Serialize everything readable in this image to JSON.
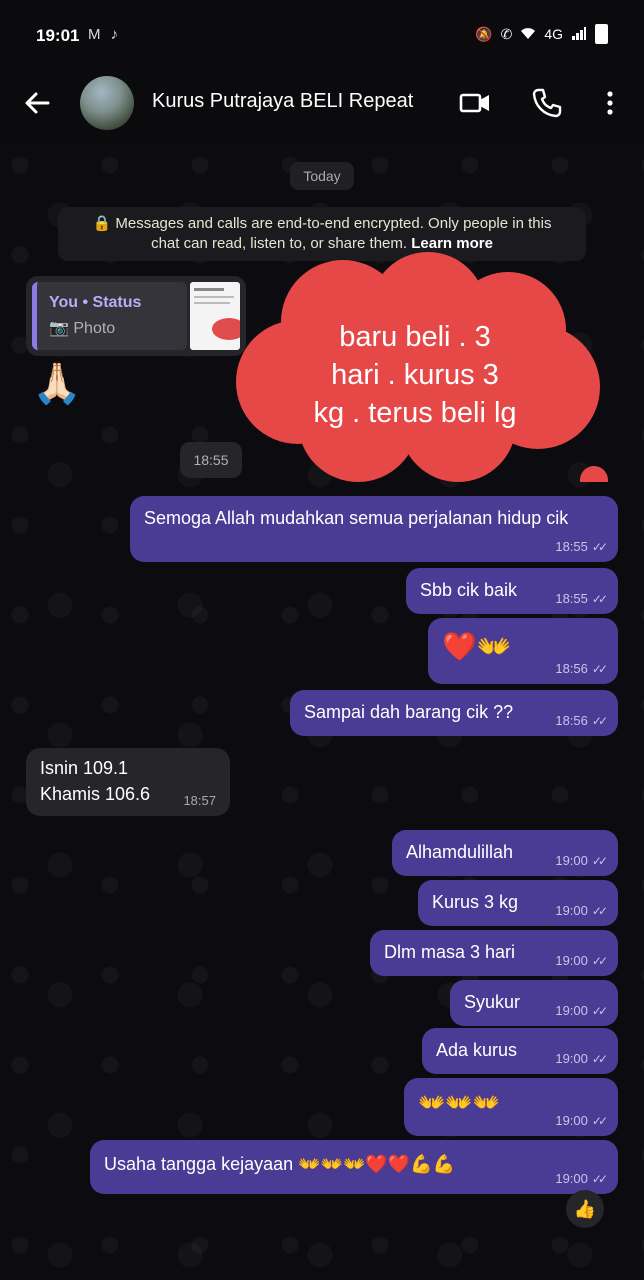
{
  "status_bar": {
    "time": "19:01",
    "left_icons": [
      "gmail-icon",
      "tiktok-icon"
    ],
    "network": "4G",
    "right_icons": [
      "mute-icon",
      "wifi-call-icon",
      "wifi-icon",
      "signal-icon",
      "battery-icon"
    ]
  },
  "header": {
    "title": "Kurus Putrajaya BELI Repeat",
    "icons": [
      "back-arrow-icon",
      "video-call-icon",
      "phone-icon",
      "more-vert-icon"
    ]
  },
  "chat": {
    "date_chip": "Today",
    "encryption_notice": {
      "line1": "🔒 Messages and calls are end-to-end encrypted. Only people in this",
      "line2_prefix": "chat can read, listen to, or share them. ",
      "link": "Learn more"
    },
    "status_reply": {
      "from": "You • Status",
      "type": "📷 Photo"
    },
    "pray_emoji": "🙏🏻",
    "incoming_time_chip": "18:55",
    "overlay_annotation": "baru beli . 3\nhari . kurus 3\nkg . terus beli lg",
    "messages": [
      {
        "dir": "out",
        "text": "Semoga Allah mudahkan semua perjalanan hidup cik",
        "time": "18:55",
        "ticks": "✓✓"
      },
      {
        "dir": "out",
        "text": "Sbb cik baik",
        "time": "18:55",
        "ticks": "✓✓"
      },
      {
        "dir": "out",
        "text": "❤️👐",
        "time": "18:56",
        "ticks": "✓✓"
      },
      {
        "dir": "out",
        "text": "Sampai dah barang cik ??",
        "time": "18:56",
        "ticks": "✓✓"
      },
      {
        "dir": "in",
        "text1": "Isnin 109.1",
        "text2": "Khamis 106.6",
        "time": "18:57"
      },
      {
        "dir": "out",
        "text": "Alhamdulillah",
        "time": "19:00",
        "ticks": "✓✓"
      },
      {
        "dir": "out",
        "text": "Kurus 3 kg",
        "time": "19:00",
        "ticks": "✓✓"
      },
      {
        "dir": "out",
        "text": "Dlm masa 3 hari",
        "time": "19:00",
        "ticks": "✓✓"
      },
      {
        "dir": "out",
        "text": "Syukur",
        "time": "19:00",
        "ticks": "✓✓"
      },
      {
        "dir": "out",
        "text": "Ada kurus",
        "time": "19:00",
        "ticks": "✓✓"
      },
      {
        "dir": "out",
        "text": "👐👐👐",
        "time": "19:00",
        "ticks": "✓✓"
      },
      {
        "dir": "out",
        "text": "Usaha tangga kejayaan 👐👐👐❤️❤️💪💪",
        "time": "19:00",
        "ticks": "✓✓"
      }
    ],
    "reaction": "👍"
  },
  "colors": {
    "outgoing_bubble": "#4a3c95",
    "incoming_bubble": "#25252a",
    "annotation_cloud": "#e64848",
    "background": "#0b0b0e"
  }
}
